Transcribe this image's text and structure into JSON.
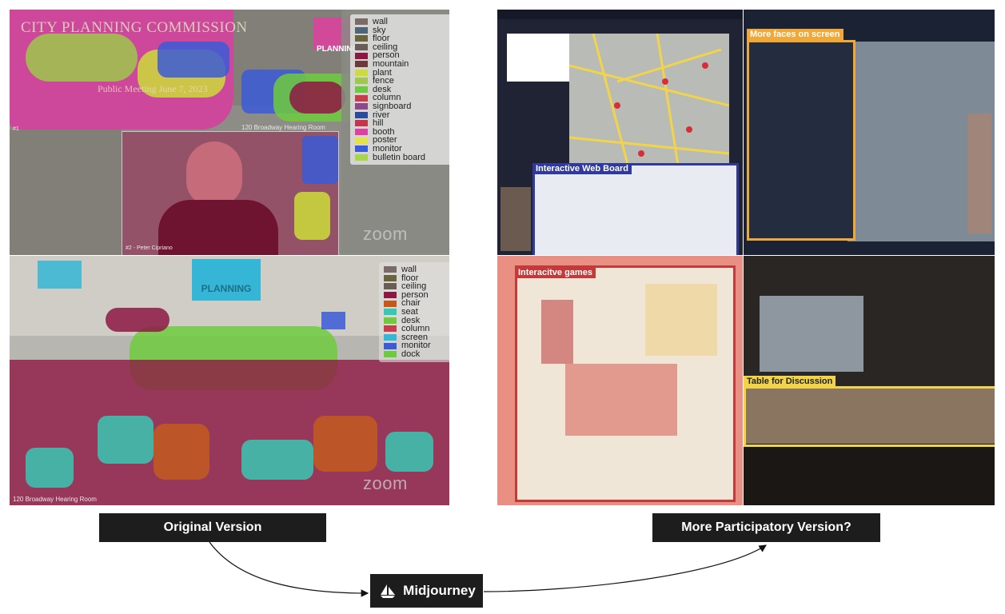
{
  "original": {
    "label": "Original Version",
    "top_frame": {
      "title": "CITY PLANNING COMMISSION",
      "meeting_title": "Public Meeting June 7, 2023",
      "nyc_planning_logo": "PLANNING",
      "room_name": "120 Broadway Hearing Room",
      "participant_name": "#2 - Peter Cipriano",
      "zoom_watermark": "zoom",
      "legend": [
        {
          "label": "wall",
          "color": "#7a6a68"
        },
        {
          "label": "sky",
          "color": "#4e6578"
        },
        {
          "label": "floor",
          "color": "#6b6340"
        },
        {
          "label": "ceiling",
          "color": "#6b5c57"
        },
        {
          "label": "person",
          "color": "#8e1844"
        },
        {
          "label": "mountain",
          "color": "#6d3a3a"
        },
        {
          "label": "plant",
          "color": "#cddc39"
        },
        {
          "label": "fence",
          "color": "#9fc84c"
        },
        {
          "label": "desk",
          "color": "#6ecb3e"
        },
        {
          "label": "column",
          "color": "#c83c4c"
        },
        {
          "label": "signboard",
          "color": "#8d4a8a"
        },
        {
          "label": "river",
          "color": "#2c4a9a"
        },
        {
          "label": "hill",
          "color": "#c2384a"
        },
        {
          "label": "booth",
          "color": "#e040a0"
        },
        {
          "label": "poster",
          "color": "#e4e24a"
        },
        {
          "label": "monitor",
          "color": "#3b5bd6"
        },
        {
          "label": "bulletin board",
          "color": "#a8d64a"
        }
      ]
    },
    "bottom_frame": {
      "room_name": "120 Broadway Hearing Room",
      "screen_text": "PLANNING",
      "zoom_watermark": "zoom",
      "legend": [
        {
          "label": "wall",
          "color": "#7a6a68"
        },
        {
          "label": "floor",
          "color": "#6b6340"
        },
        {
          "label": "ceiling",
          "color": "#6b5c57"
        },
        {
          "label": "person",
          "color": "#8e1844"
        },
        {
          "label": "chair",
          "color": "#c25a1e"
        },
        {
          "label": "seat",
          "color": "#38c7b4"
        },
        {
          "label": "desk",
          "color": "#6ecb3e"
        },
        {
          "label": "column",
          "color": "#c83c4c"
        },
        {
          "label": "screen",
          "color": "#36b6d6"
        },
        {
          "label": "monitor",
          "color": "#3b5bd6"
        },
        {
          "label": "dock",
          "color": "#6ecb3e"
        }
      ]
    }
  },
  "participatory": {
    "label": "More Participatory Version?",
    "highlights": {
      "web_board": "Interactive Web Board",
      "faces": "More faces on screen",
      "games": "Interacitve games",
      "table": "Table for Discussion"
    }
  },
  "flow": {
    "tool_label": "Midjourney"
  },
  "colors": {
    "web_board_highlight": "#2f3a9c",
    "faces_highlight": "#f0a838",
    "games_highlight": "#c43a3a",
    "table_highlight": "#f2d44a"
  }
}
